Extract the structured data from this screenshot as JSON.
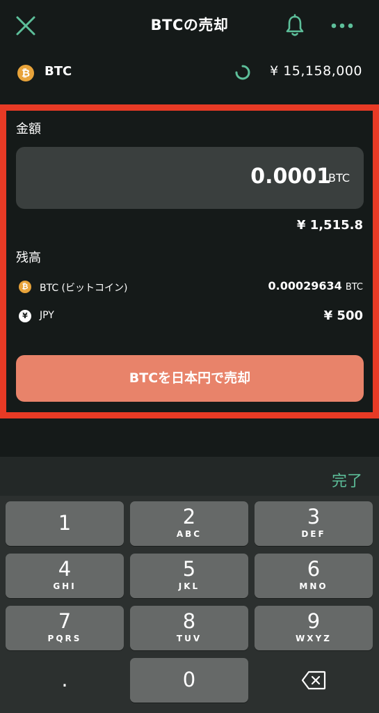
{
  "header": {
    "title": "BTCの売却",
    "close_icon": "close-icon",
    "bell_icon": "bell-icon",
    "more_icon": "more-icon"
  },
  "asset": {
    "symbol_glyph": "₿",
    "name": "BTC",
    "price": "¥ 15,158,000"
  },
  "amount": {
    "label": "金額",
    "value": "0.0001",
    "unit": "BTC",
    "jpy_equivalent": "¥ 1,515.8"
  },
  "balance": {
    "label": "残高",
    "items": [
      {
        "glyph": "₿",
        "name": "BTC (ビットコイン)",
        "value": "0.00029634",
        "unit": "BTC"
      },
      {
        "glyph": "¥",
        "name": "JPY",
        "value": "¥ 500",
        "unit": ""
      }
    ]
  },
  "sell_button": {
    "label": "BTCを日本円で売却"
  },
  "keyboard": {
    "done_label": "完了",
    "keys": [
      {
        "num": "1",
        "sub": ""
      },
      {
        "num": "2",
        "sub": "ABC"
      },
      {
        "num": "3",
        "sub": "DEF"
      },
      {
        "num": "4",
        "sub": "GHI"
      },
      {
        "num": "5",
        "sub": "JKL"
      },
      {
        "num": "6",
        "sub": "MNO"
      },
      {
        "num": "7",
        "sub": "PQRS"
      },
      {
        "num": "8",
        "sub": "TUV"
      },
      {
        "num": "9",
        "sub": "WXYZ"
      },
      {
        "num": ".",
        "sub": ""
      },
      {
        "num": "0",
        "sub": ""
      }
    ],
    "delete_icon": "backspace-icon"
  },
  "colors": {
    "background": "#151a19",
    "accent_green": "#5dbf9a",
    "highlight_red": "#e83a25",
    "sell_button": "#e8836a",
    "btc_orange": "#e8a33a"
  }
}
